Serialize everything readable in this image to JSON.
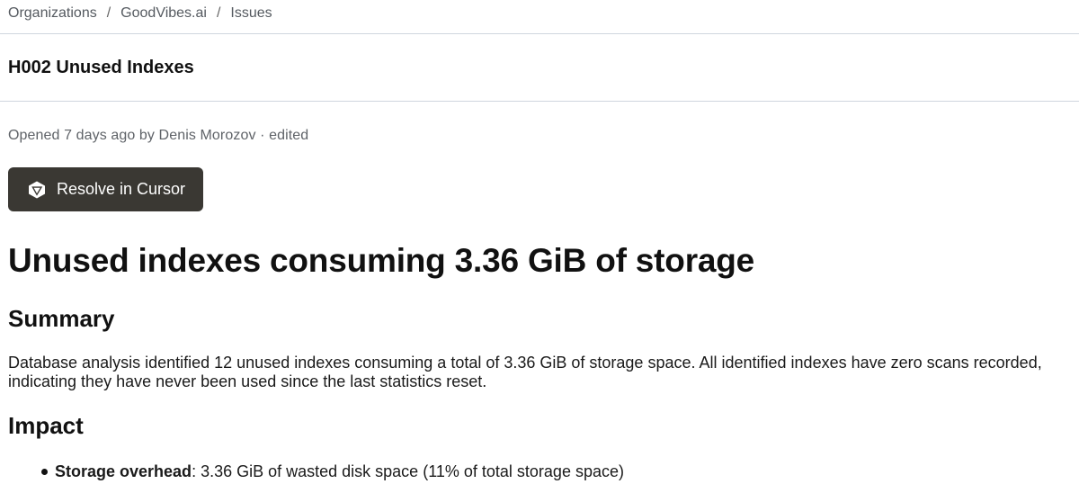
{
  "breadcrumb": {
    "items": [
      "Organizations",
      "GoodVibes.ai",
      "Issues"
    ],
    "separator": "/"
  },
  "issue": {
    "id_title": "H002 Unused Indexes",
    "meta": "Opened 7 days ago by Denis Morozov · edited"
  },
  "actions": {
    "resolve_label": "Resolve in Cursor",
    "resolve_icon": "cursor-logo-icon"
  },
  "content": {
    "heading": "Unused indexes consuming 3.36 GiB of storage",
    "summary_heading": "Summary",
    "summary_text": "Database analysis identified 12 unused indexes consuming a total of 3.36 GiB of storage space. All identified indexes have zero scans recorded, indicating they have never been used since the last statistics reset.",
    "impact_heading": "Impact",
    "impact_items": [
      {
        "label": "Storage overhead",
        "text": ": 3.36 GiB of wasted disk space (11% of total storage space)"
      }
    ]
  },
  "colors": {
    "button_bg": "#3a3833",
    "divider": "#cfd6de",
    "muted_text": "#555a60"
  }
}
